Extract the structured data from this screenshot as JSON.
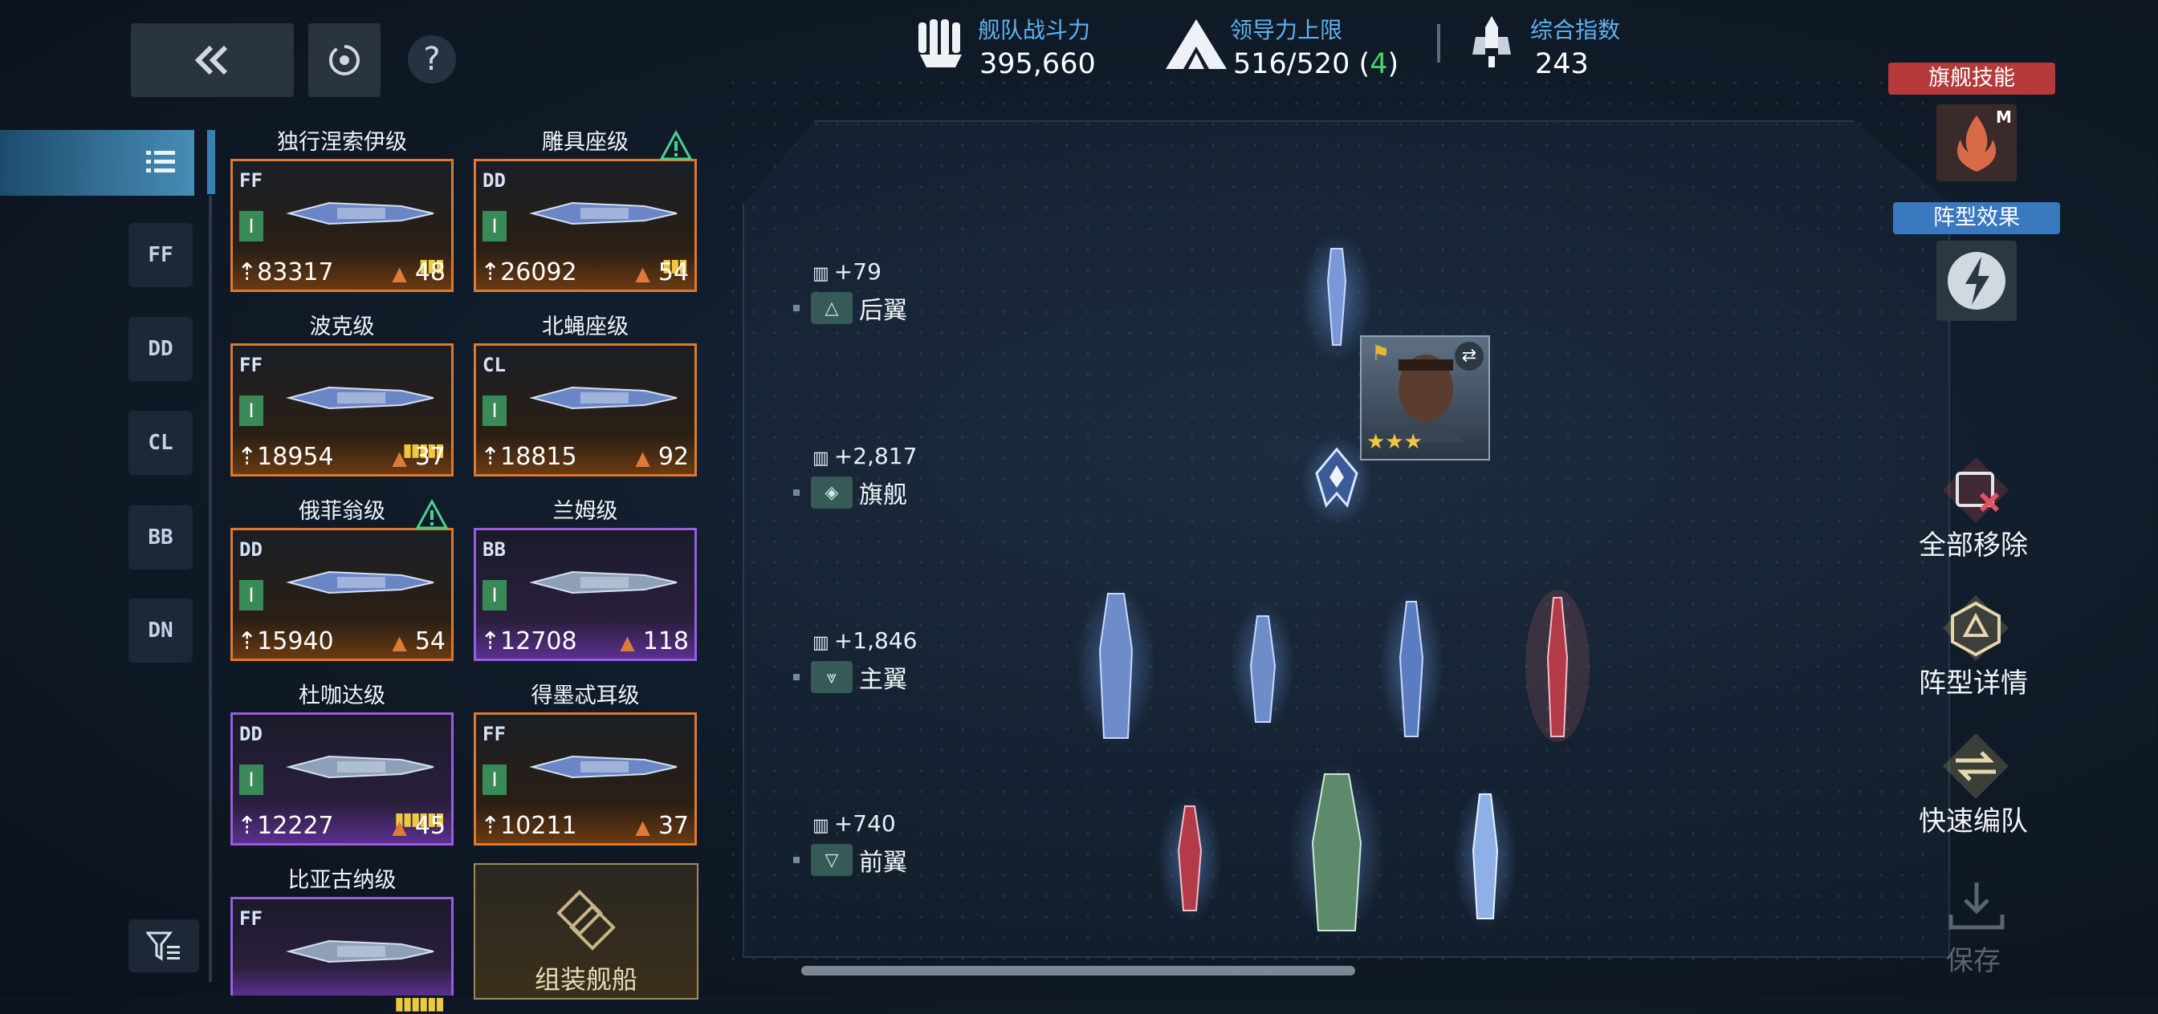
{
  "top_bar": {
    "back_icon": "double-chevron-left-icon",
    "target_icon": "target-icon",
    "help_label": "?",
    "fleet_power_label": "舰队战斗力",
    "fleet_power_value": "395,660",
    "leadership_label": "领导力上限",
    "leadership_value": "516/520 (",
    "leadership_extra": "4",
    "leadership_close": ")",
    "composite_label": "综合指数",
    "composite_value": "243"
  },
  "sidebar": {
    "tabs": [
      "FF",
      "DD",
      "CL",
      "BB",
      "DN"
    ],
    "filter_icon": "filter-icon"
  },
  "ships": [
    {
      "name": "独行涅索伊级",
      "class": "FF",
      "level": "I",
      "power": "83317",
      "cost": "48",
      "rarity": "orange",
      "pips": "▮▮▮"
    },
    {
      "name": "雕具座级",
      "class": "DD",
      "level": "I",
      "power": "26092",
      "cost": "54",
      "rarity": "orange",
      "pips": "▮▮▮"
    },
    {
      "name": "波克级",
      "class": "FF",
      "level": "I",
      "power": "18954",
      "cost": "37",
      "rarity": "orange",
      "pips": "▮▮▮▮▮"
    },
    {
      "name": "北蝇座级",
      "class": "CL",
      "level": "I",
      "power": "18815",
      "cost": "92",
      "rarity": "orange",
      "pips": ""
    },
    {
      "name": "俄菲翁级",
      "class": "DD",
      "level": "I",
      "power": "15940",
      "cost": "54",
      "rarity": "orange",
      "pips": ""
    },
    {
      "name": "兰姆级",
      "class": "BB",
      "level": "I",
      "power": "12708",
      "cost": "118",
      "rarity": "purple",
      "pips": ""
    },
    {
      "name": "杜咖达级",
      "class": "DD",
      "level": "I",
      "power": "12227",
      "cost": "45",
      "rarity": "purple",
      "pips": "▮▮▮▮▮▮"
    },
    {
      "name": "得墨忒耳级",
      "class": "FF",
      "level": "I",
      "power": "10211",
      "cost": "37",
      "rarity": "orange",
      "pips": ""
    },
    {
      "name": "比亚古纳级",
      "class": "FF",
      "level": "",
      "power": "",
      "cost": "",
      "rarity": "purple",
      "pips": "▮▮▮▮▮▮"
    }
  ],
  "assemble_card": {
    "label": "组装舰船"
  },
  "formation": {
    "rows": [
      {
        "bonus": "+79",
        "name": "后翼"
      },
      {
        "bonus": "+2,817",
        "name": "旗舰"
      },
      {
        "bonus": "+1,846",
        "name": "主翼"
      },
      {
        "bonus": "+740",
        "name": "前翼"
      }
    ],
    "commander_stars": "★★★"
  },
  "right_panel": {
    "flagship_skill": "旗舰技能",
    "skill_badge": "M",
    "formation_effect": "阵型效果",
    "remove_all": "全部移除",
    "formation_details": "阵型详情",
    "quick_form": "快速编队",
    "save": "保存"
  },
  "colors": {
    "accent_blue": "#5db3ee",
    "orange_rarity": "#e0782a",
    "purple_rarity": "#9a5ce0",
    "green_highlight": "#47d26b",
    "skill_red": "#b63a3a",
    "effect_blue": "#3a78c0"
  }
}
